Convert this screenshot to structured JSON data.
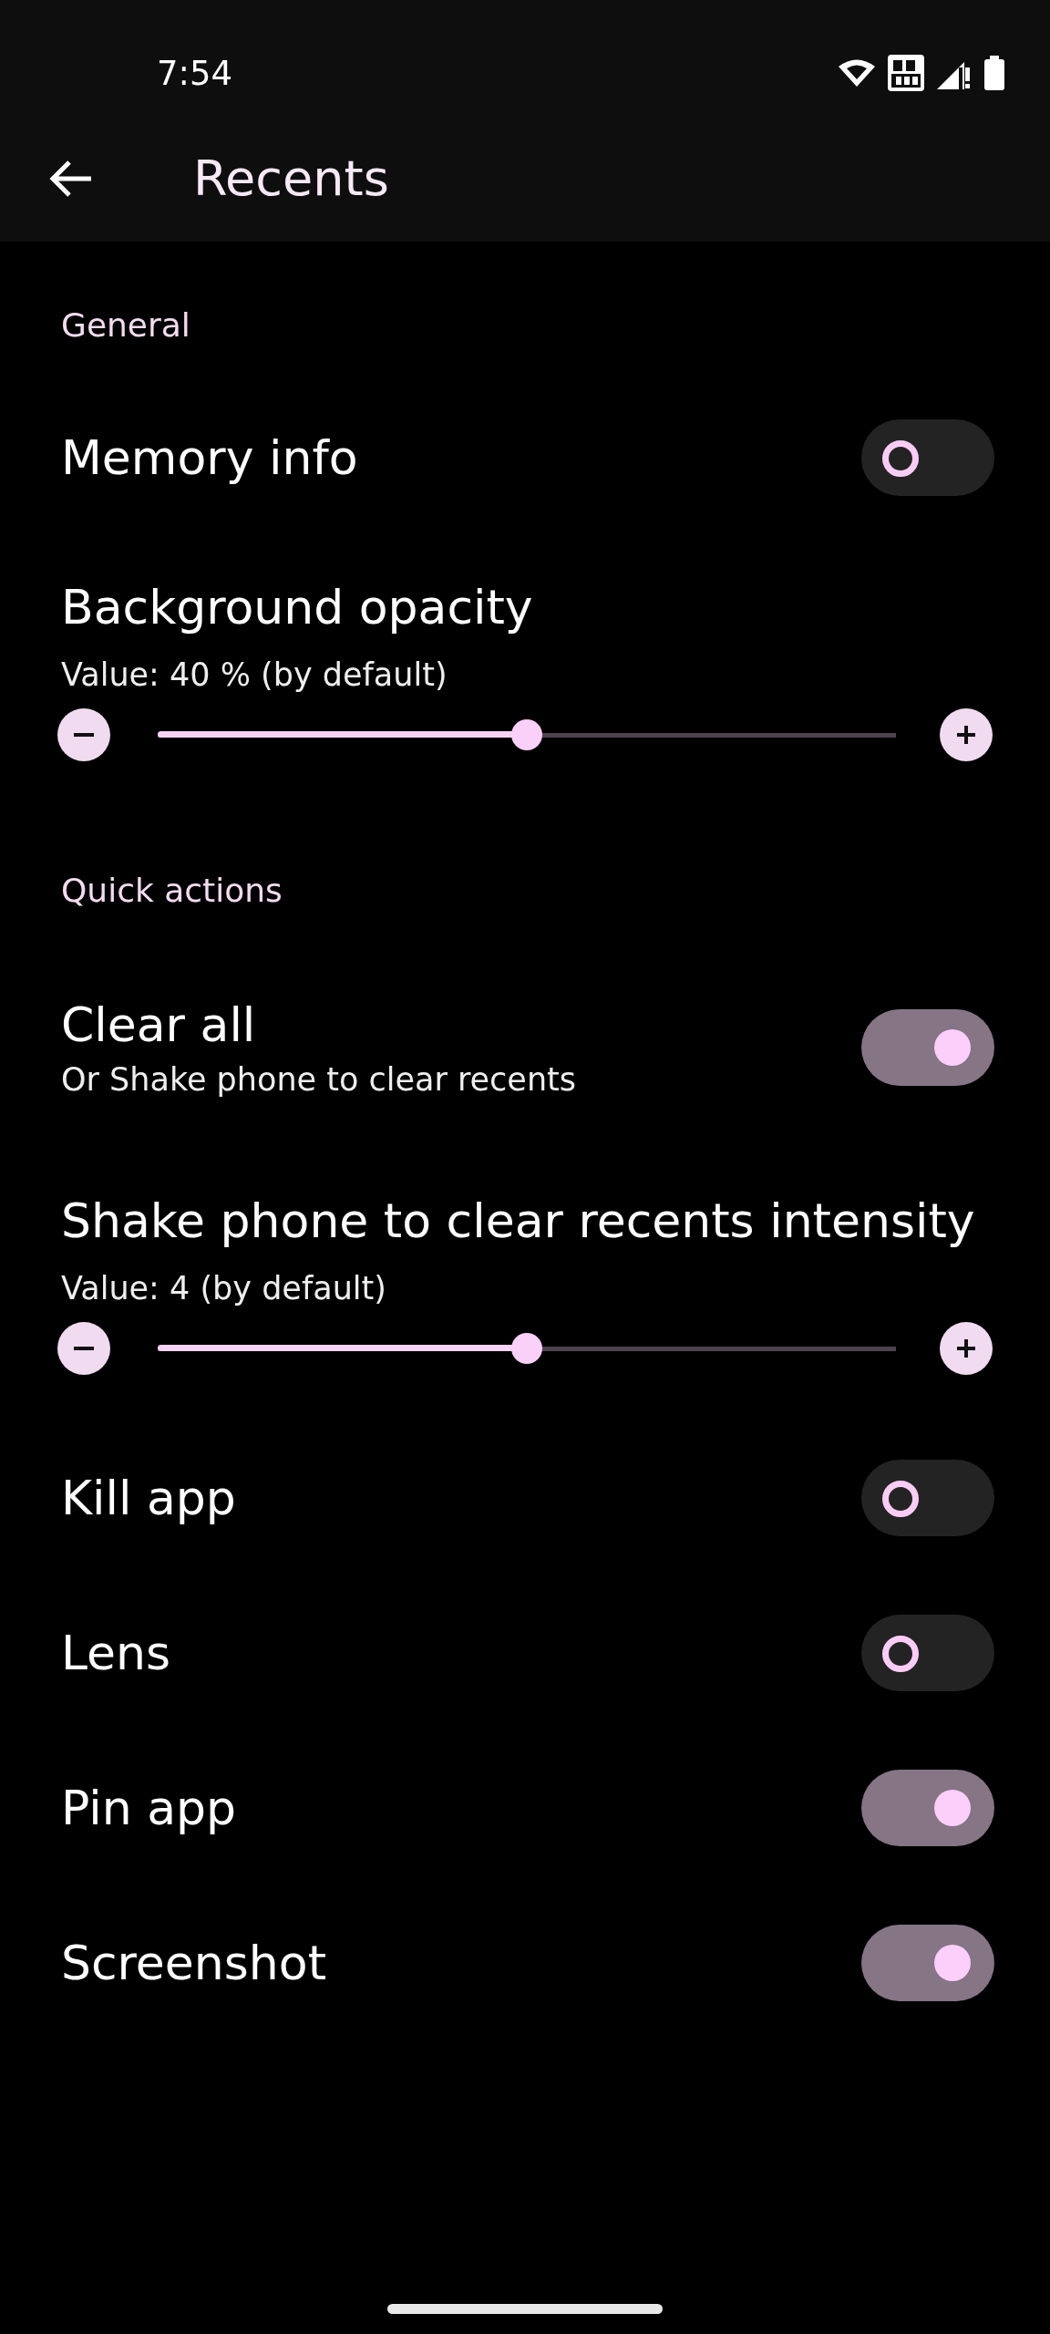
{
  "status_bar": {
    "time": "7:54"
  },
  "app_bar": {
    "title": "Recents"
  },
  "items": [
    {
      "kind": "section",
      "title": "General"
    },
    {
      "kind": "toggle",
      "title": "Memory info",
      "on": false
    },
    {
      "kind": "slider",
      "title": "Background opacity",
      "value": "Value: 40 % (by default)",
      "level": 0.5
    },
    {
      "kind": "section",
      "title": "Quick actions"
    },
    {
      "kind": "toggle",
      "title": "Clear all",
      "subtitle": "Or Shake phone to clear recents",
      "on": true
    },
    {
      "kind": "slider",
      "title": "Shake phone to clear recents intensity",
      "value": "Value: 4 (by default)",
      "level": 0.5
    },
    {
      "kind": "toggle",
      "title": "Kill app",
      "on": false
    },
    {
      "kind": "toggle",
      "title": "Lens",
      "on": false
    },
    {
      "kind": "toggle",
      "title": "Pin app",
      "on": true
    },
    {
      "kind": "toggle",
      "title": "Screenshot",
      "on": true
    }
  ]
}
